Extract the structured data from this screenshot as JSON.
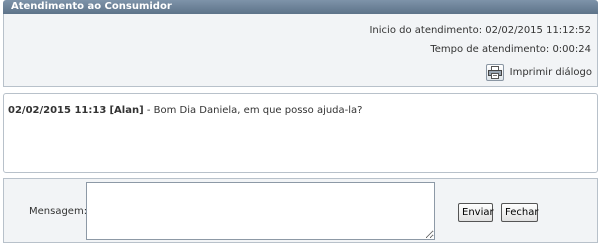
{
  "window": {
    "title": "Atendimento ao Consumidor"
  },
  "info": {
    "start_label": "Inicio do atendimento:",
    "start_value": "02/02/2015 11:12:52",
    "elapsed_label": "Tempo de atendimento:",
    "elapsed_value": "0:00:24",
    "print_label": "Imprimir diálogo"
  },
  "dialog": {
    "messages": [
      {
        "timestamp": "02/02/2015 11:13",
        "sender": "[Alan]",
        "separator": " - ",
        "text": "Bom Dia Daniela, em que posso ajuda-la?"
      }
    ]
  },
  "message_form": {
    "label": "Mensagem:",
    "value": "",
    "send_label": "Enviar",
    "close_label": "Fechar"
  }
}
